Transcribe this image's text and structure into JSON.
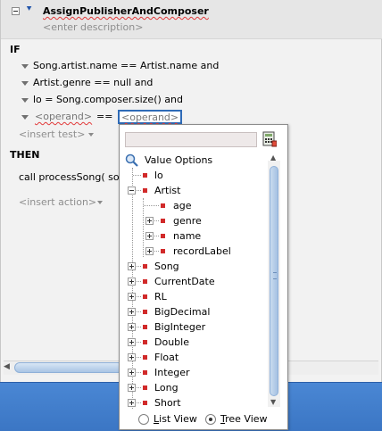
{
  "rule": {
    "title": "AssignPublisherAndComposer",
    "description_placeholder": "<enter description>",
    "if_label": "IF",
    "tests": [
      "Song.artist.name  ==  Artist.name and",
      "Artist.genre  ==  null and",
      "lo = Song.composer.size() and"
    ],
    "operand_left": "<operand>",
    "operator": "==",
    "operand_right": "<operand>",
    "insert_test": "<insert test>",
    "then_label": "THEN",
    "action": "call processSong( so",
    "insert_action": "<insert action>"
  },
  "popup": {
    "search_value": "",
    "calculator_icon": "calculator-icon",
    "root_label": "Value Options",
    "root_icon": "magnifier-icon",
    "tree": [
      {
        "label": "lo",
        "level": 1,
        "toggle": "none"
      },
      {
        "label": "Artist",
        "level": 1,
        "toggle": "minus"
      },
      {
        "label": "age",
        "level": 2,
        "toggle": "none"
      },
      {
        "label": "genre",
        "level": 2,
        "toggle": "plus"
      },
      {
        "label": "name",
        "level": 2,
        "toggle": "plus"
      },
      {
        "label": "recordLabel",
        "level": 2,
        "toggle": "plus"
      },
      {
        "label": "Song",
        "level": 0,
        "toggle": "plus"
      },
      {
        "label": "CurrentDate",
        "level": 0,
        "toggle": "plus"
      },
      {
        "label": "RL",
        "level": 0,
        "toggle": "plus"
      },
      {
        "label": "BigDecimal",
        "level": 0,
        "toggle": "plus"
      },
      {
        "label": "BigInteger",
        "level": 0,
        "toggle": "plus"
      },
      {
        "label": "Double",
        "level": 0,
        "toggle": "plus"
      },
      {
        "label": "Float",
        "level": 0,
        "toggle": "plus"
      },
      {
        "label": "Integer",
        "level": 0,
        "toggle": "plus"
      },
      {
        "label": "Long",
        "level": 0,
        "toggle": "plus"
      },
      {
        "label": "Short",
        "level": 0,
        "toggle": "plus"
      }
    ],
    "list_view_label": "List View",
    "tree_view_label": "Tree View",
    "selected_view": "Tree View"
  },
  "colors": {
    "accent_blue": "#2f6bb7",
    "bottom_bar": "#3b76c4",
    "error_underline": "#e23a3a",
    "node_marker": "#d12a2a"
  }
}
